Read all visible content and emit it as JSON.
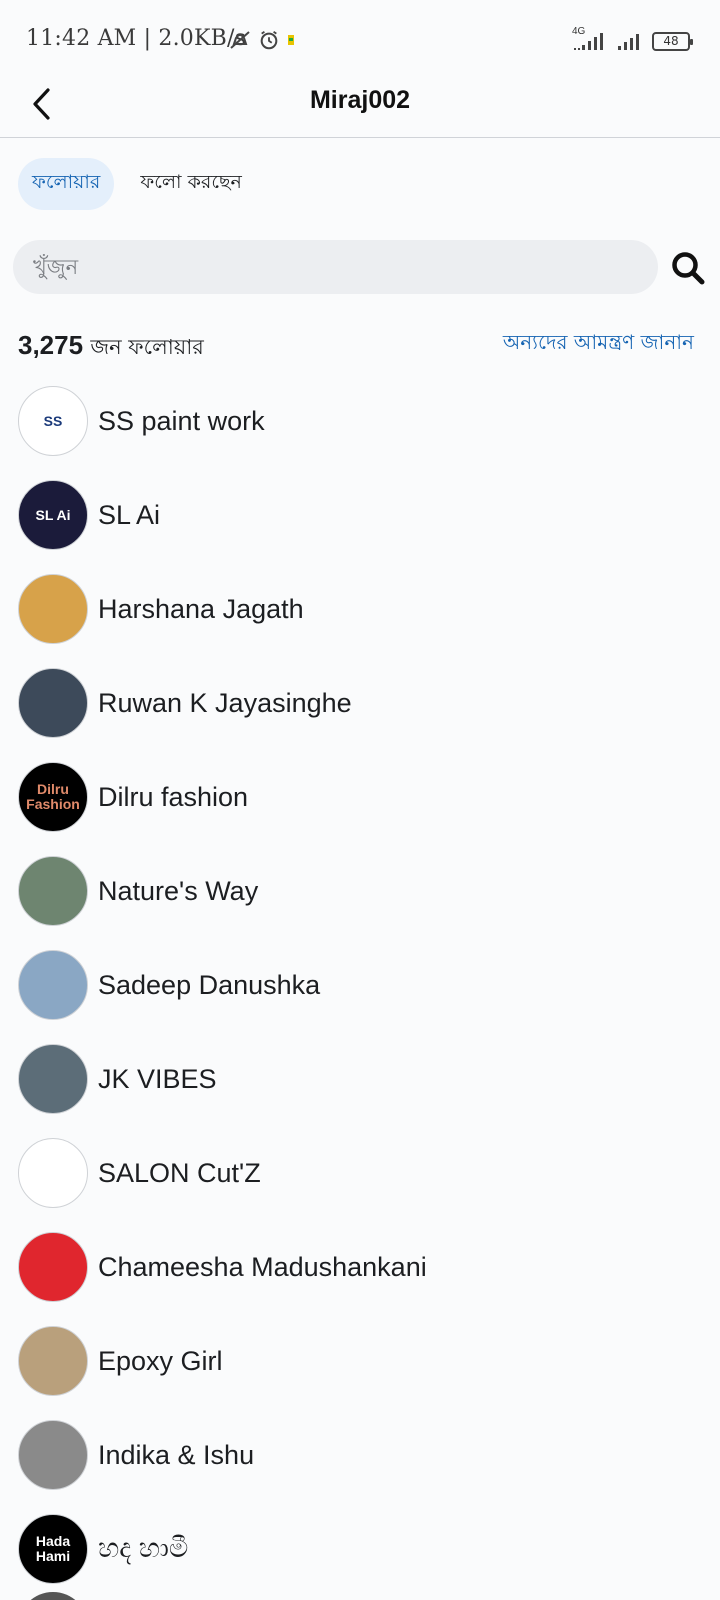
{
  "status_bar": {
    "time_speed": "11:42 AM | 2.0KB/s",
    "network": "4G",
    "battery": "48"
  },
  "header": {
    "title": "Miraj002"
  },
  "tabs": [
    {
      "label": "ফলোয়ার",
      "active": true
    },
    {
      "label": "ফলো করছেন",
      "active": false
    }
  ],
  "search": {
    "placeholder": "খুঁজুন"
  },
  "followers": {
    "count": "3,275",
    "count_suffix": "জন ফলোয়ার",
    "invite_label": "অন্যদের আমন্ত্রণ জানান"
  },
  "list": [
    {
      "name": "SS paint work",
      "avatar_text": "SS",
      "avatar_bg": "#ffffff",
      "avatar_fg": "#1b3a7a"
    },
    {
      "name": "SL Ai",
      "avatar_text": "SL Ai",
      "avatar_bg": "#1b1b3a",
      "avatar_fg": "#ffffff"
    },
    {
      "name": "Harshana Jagath",
      "avatar_text": "",
      "avatar_bg": "#d7a24a",
      "avatar_fg": "#ffffff"
    },
    {
      "name": "Ruwan K Jayasinghe",
      "avatar_text": "",
      "avatar_bg": "#3d4a5a",
      "avatar_fg": "#ffffff"
    },
    {
      "name": "Dilru fashion",
      "avatar_text": "Dilru Fashion",
      "avatar_bg": "#000000",
      "avatar_fg": "#e08a6a"
    },
    {
      "name": "Nature's Way",
      "avatar_text": "",
      "avatar_bg": "#6e8570",
      "avatar_fg": "#ffffff"
    },
    {
      "name": "Sadeep Danushka",
      "avatar_text": "",
      "avatar_bg": "#8aa7c4",
      "avatar_fg": "#ffffff"
    },
    {
      "name": "JK VIBES",
      "avatar_text": "",
      "avatar_bg": "#5c6d78",
      "avatar_fg": "#ffffff"
    },
    {
      "name": "SALON Cut'Z",
      "avatar_text": "",
      "avatar_bg": "#ffffff",
      "avatar_fg": "#222222"
    },
    {
      "name": "Chameesha Madushankani",
      "avatar_text": "",
      "avatar_bg": "#e0262e",
      "avatar_fg": "#ffffff"
    },
    {
      "name": "Epoxy Girl",
      "avatar_text": "",
      "avatar_bg": "#b9a07c",
      "avatar_fg": "#ffffff"
    },
    {
      "name": "Indika & Ishu",
      "avatar_text": "",
      "avatar_bg": "#8a8a8a",
      "avatar_fg": "#ffffff"
    },
    {
      "name": "හද හාමී",
      "avatar_text": "Hada Hami",
      "avatar_bg": "#000000",
      "avatar_fg": "#ffffff"
    }
  ],
  "colors": {
    "accent": "#1463b2",
    "active_tab_bg": "#e4effb",
    "search_bg": "#eceef1"
  }
}
